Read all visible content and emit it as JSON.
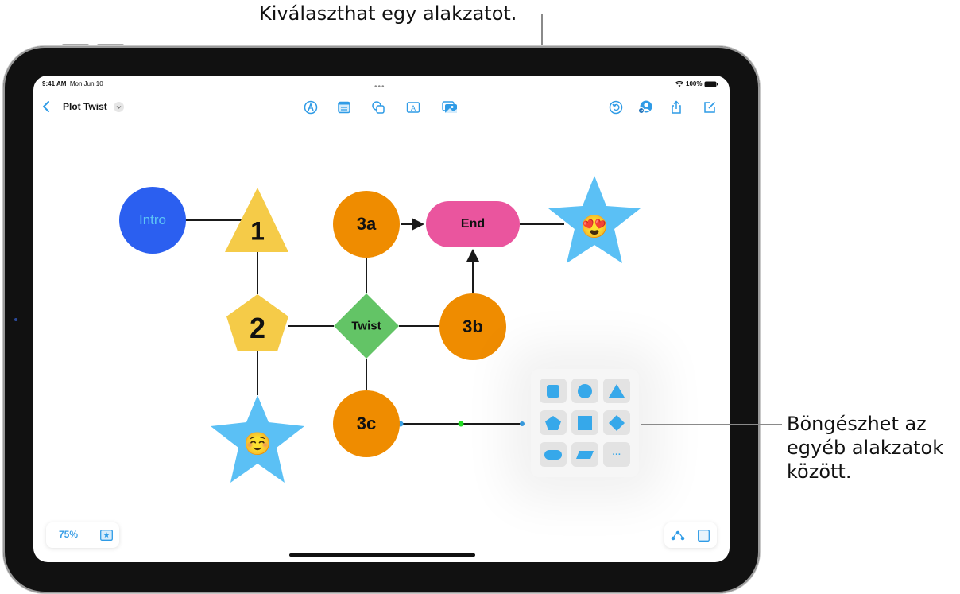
{
  "callouts": {
    "top": "Kiválaszthat egy alakzatot.",
    "right_lines": [
      "Böngészhet az",
      "egyéb alakzatok",
      "között."
    ]
  },
  "status_bar": {
    "time": "9:41 AM",
    "date": "Mon Jun 10",
    "battery": "100%"
  },
  "toolbar": {
    "back_icon": "chevron-left-icon",
    "document_title": "Plot Twist",
    "title_menu_icon": "chevron-down-icon",
    "center_icons": [
      "pen-icon",
      "sticky-note-icon",
      "shapes-icon",
      "text-box-icon",
      "media-icon"
    ],
    "right_icons": [
      "undo-icon",
      "collaborate-icon",
      "share-icon",
      "compose-icon"
    ]
  },
  "board": {
    "nodes": [
      {
        "id": "intro",
        "label": "Intro",
        "shape": "circle",
        "color": "#2b5ff0",
        "text_color": "#5ec6f5"
      },
      {
        "id": "n1",
        "label": "1",
        "shape": "triangle",
        "color": "#f5cb48"
      },
      {
        "id": "n2",
        "label": "2",
        "shape": "pentagon",
        "color": "#f5cb48"
      },
      {
        "id": "star-smile",
        "label": "☺️",
        "shape": "star",
        "color": "#5bc0f5"
      },
      {
        "id": "n3a",
        "label": "3a",
        "shape": "circle",
        "color": "#ef8c00"
      },
      {
        "id": "twist",
        "label": "Twist",
        "shape": "diamond",
        "color": "#63c466"
      },
      {
        "id": "n3c",
        "label": "3c",
        "shape": "circle",
        "color": "#ef8c00"
      },
      {
        "id": "end",
        "label": "End",
        "shape": "rounded-rect",
        "color": "#ea559e"
      },
      {
        "id": "n3b",
        "label": "3b",
        "shape": "circle",
        "color": "#ef8c00"
      },
      {
        "id": "star-love",
        "label": "😍",
        "shape": "star",
        "color": "#5bc0f5"
      }
    ],
    "connections": [
      {
        "from": "intro",
        "to": "n1",
        "arrow": false
      },
      {
        "from": "n1",
        "to": "n2",
        "arrow": false
      },
      {
        "from": "n2",
        "to": "star-smile",
        "arrow": false
      },
      {
        "from": "n2",
        "to": "twist",
        "arrow": false
      },
      {
        "from": "twist",
        "to": "n3b",
        "arrow": false
      },
      {
        "from": "twist",
        "to": "n3a",
        "arrow": false
      },
      {
        "from": "twist",
        "to": "n3c",
        "arrow": false
      },
      {
        "from": "n3a",
        "to": "end",
        "arrow": true
      },
      {
        "from": "n3b",
        "to": "end",
        "arrow": true
      },
      {
        "from": "end",
        "to": "star-love",
        "arrow": false
      },
      {
        "from": "n3c",
        "to": "shape-popover",
        "arrow": false,
        "selected": true
      }
    ]
  },
  "shape_picker": {
    "options": [
      {
        "name": "rounded-square",
        "icon": "rounded-square-icon"
      },
      {
        "name": "circle",
        "icon": "circle-icon"
      },
      {
        "name": "triangle",
        "icon": "triangle-icon"
      },
      {
        "name": "pentagon",
        "icon": "pentagon-icon"
      },
      {
        "name": "square",
        "icon": "square-icon"
      },
      {
        "name": "diamond",
        "icon": "diamond-icon"
      },
      {
        "name": "pill",
        "icon": "pill-icon"
      },
      {
        "name": "parallelogram",
        "icon": "parallelogram-icon"
      },
      {
        "name": "more",
        "icon": "more-icon",
        "label": "···"
      }
    ],
    "accent": "#36a8ea"
  },
  "bottom_bar": {
    "zoom_level": "75%",
    "favorites_icon": "star-box-icon",
    "right_icons": [
      "connection-icon",
      "grid-icon"
    ]
  },
  "colors": {
    "accent": "#2f9be6",
    "line": "#1a1a1a",
    "handle_blue": "#3aa0e6",
    "handle_green": "#22dd22"
  }
}
